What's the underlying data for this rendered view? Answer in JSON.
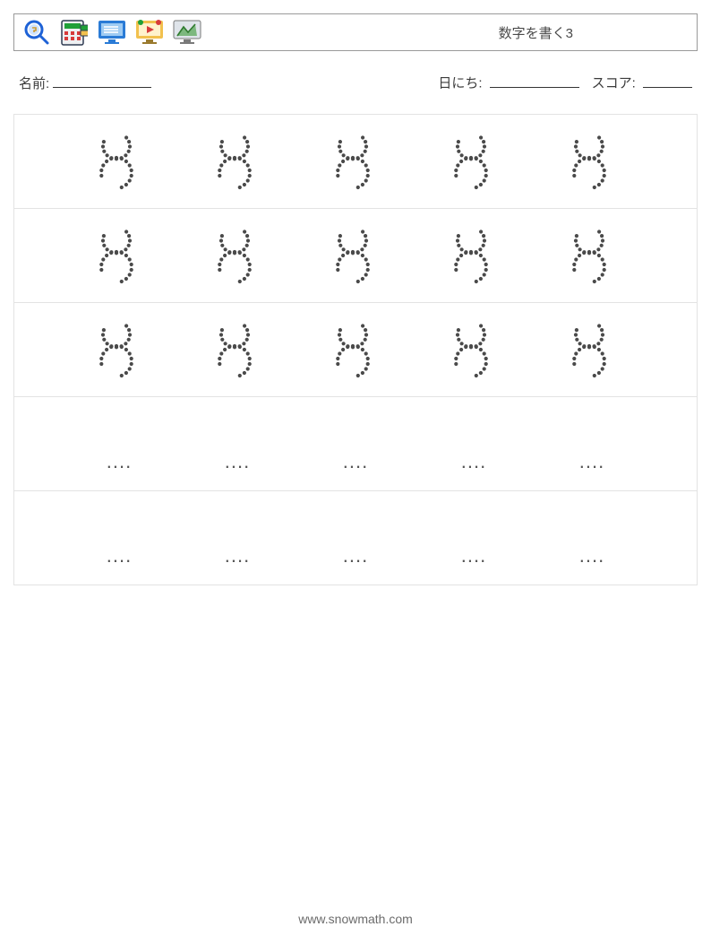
{
  "header": {
    "title": "数字を書く3",
    "icons": [
      {
        "name": "magnifier-key-icon"
      },
      {
        "name": "calculator-icon"
      },
      {
        "name": "monitor-list-icon"
      },
      {
        "name": "monitor-play-icon"
      },
      {
        "name": "monitor-chart-icon"
      }
    ]
  },
  "info": {
    "name_label": "名前:",
    "date_label": "日にち:",
    "score_label": "スコア:"
  },
  "worksheet": {
    "traced_digit": "3",
    "traced_rows": 3,
    "blank_rows": 2,
    "columns": 5,
    "placeholder": "...."
  },
  "footer": {
    "url": "www.snowmath.com"
  }
}
